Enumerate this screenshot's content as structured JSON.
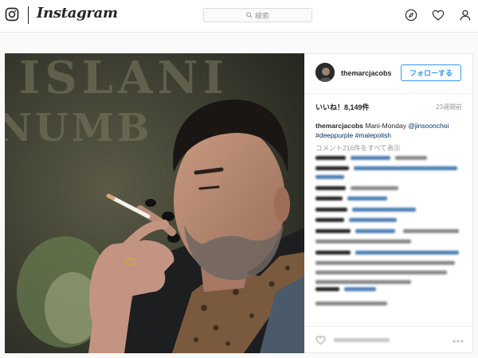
{
  "app": {
    "name": "Instagram"
  },
  "search": {
    "placeholder": "検索"
  },
  "post": {
    "username": "themarcjacobs",
    "follow_label": "フォローする",
    "likes": "いいね！8,149件",
    "time_ago": "23週間前",
    "caption": {
      "username": "themarcjacobs",
      "text": "Mani-Monday",
      "mention": "@jinsoonchoi",
      "hashtags": [
        "#deeppurple",
        "#malepolish"
      ]
    },
    "view_all_comments": "コメント216件をすべて表示"
  }
}
